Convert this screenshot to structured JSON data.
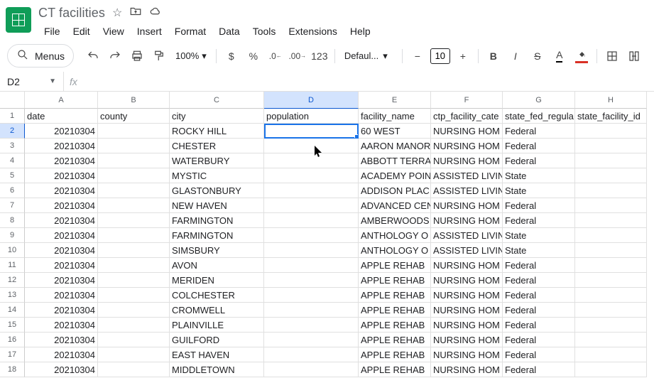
{
  "header": {
    "doc_title": "CT facilities",
    "star_icon": "star-icon",
    "move_icon": "move-icon",
    "cloud_icon": "cloud-icon"
  },
  "menus": [
    "File",
    "Edit",
    "View",
    "Insert",
    "Format",
    "Data",
    "Tools",
    "Extensions",
    "Help"
  ],
  "toolbar": {
    "search_label": "Menus",
    "zoom": "100%",
    "font": "Defaul...",
    "font_size": "10",
    "format_number": "123"
  },
  "name_box": {
    "ref": "D2",
    "fx": "fx"
  },
  "columns": [
    {
      "letter": "A",
      "cls": "w-a"
    },
    {
      "letter": "B",
      "cls": "w-b"
    },
    {
      "letter": "C",
      "cls": "w-c"
    },
    {
      "letter": "D",
      "cls": "w-d",
      "selected": true
    },
    {
      "letter": "E",
      "cls": "w-e"
    },
    {
      "letter": "F",
      "cls": "w-f"
    },
    {
      "letter": "G",
      "cls": "w-g"
    },
    {
      "letter": "H",
      "cls": "w-h"
    }
  ],
  "col_widths": [
    "w-a",
    "w-b",
    "w-c",
    "w-d",
    "w-e",
    "w-f",
    "w-g",
    "w-h"
  ],
  "active_cell": {
    "row": 2,
    "col": 3
  },
  "rows": [
    {
      "n": 1,
      "cells": [
        "date",
        "county",
        "city",
        "population",
        "facility_name",
        "ctp_facility_cate",
        "state_fed_regula",
        "state_facility_id"
      ],
      "num_cols": []
    },
    {
      "n": 2,
      "cells": [
        "20210304",
        "",
        "ROCKY HILL",
        "",
        "60 WEST",
        "NURSING HOM",
        "Federal",
        ""
      ],
      "num_cols": [
        0
      ],
      "selected": true
    },
    {
      "n": 3,
      "cells": [
        "20210304",
        "",
        "CHESTER",
        "",
        "AARON MANOR",
        "NURSING HOM",
        "Federal",
        ""
      ],
      "num_cols": [
        0
      ]
    },
    {
      "n": 4,
      "cells": [
        "20210304",
        "",
        "WATERBURY",
        "",
        "ABBOTT TERRA",
        "NURSING HOM",
        "Federal",
        ""
      ],
      "num_cols": [
        0
      ]
    },
    {
      "n": 5,
      "cells": [
        "20210304",
        "",
        "MYSTIC",
        "",
        "ACADEMY POIN",
        "ASSISTED LIVIN",
        "State",
        ""
      ],
      "num_cols": [
        0
      ]
    },
    {
      "n": 6,
      "cells": [
        "20210304",
        "",
        "GLASTONBURY",
        "",
        "ADDISON PLAC",
        "ASSISTED LIVIN",
        "State",
        ""
      ],
      "num_cols": [
        0
      ]
    },
    {
      "n": 7,
      "cells": [
        "20210304",
        "",
        "NEW HAVEN",
        "",
        "ADVANCED CEN",
        "NURSING HOM",
        "Federal",
        ""
      ],
      "num_cols": [
        0
      ]
    },
    {
      "n": 8,
      "cells": [
        "20210304",
        "",
        "FARMINGTON",
        "",
        "AMBERWOODS",
        "NURSING HOM",
        "Federal",
        ""
      ],
      "num_cols": [
        0
      ]
    },
    {
      "n": 9,
      "cells": [
        "20210304",
        "",
        "FARMINGTON",
        "",
        "ANTHOLOGY O",
        "ASSISTED LIVIN",
        "State",
        ""
      ],
      "num_cols": [
        0
      ]
    },
    {
      "n": 10,
      "cells": [
        "20210304",
        "",
        "SIMSBURY",
        "",
        "ANTHOLOGY O",
        "ASSISTED LIVIN",
        "State",
        ""
      ],
      "num_cols": [
        0
      ]
    },
    {
      "n": 11,
      "cells": [
        "20210304",
        "",
        "AVON",
        "",
        "APPLE REHAB",
        "NURSING HOM",
        "Federal",
        ""
      ],
      "num_cols": [
        0
      ]
    },
    {
      "n": 12,
      "cells": [
        "20210304",
        "",
        "MERIDEN",
        "",
        "APPLE REHAB",
        "NURSING HOM",
        "Federal",
        ""
      ],
      "num_cols": [
        0
      ]
    },
    {
      "n": 13,
      "cells": [
        "20210304",
        "",
        "COLCHESTER",
        "",
        "APPLE REHAB",
        "NURSING HOM",
        "Federal",
        ""
      ],
      "num_cols": [
        0
      ]
    },
    {
      "n": 14,
      "cells": [
        "20210304",
        "",
        "CROMWELL",
        "",
        "APPLE REHAB",
        "NURSING HOM",
        "Federal",
        ""
      ],
      "num_cols": [
        0
      ]
    },
    {
      "n": 15,
      "cells": [
        "20210304",
        "",
        "PLAINVILLE",
        "",
        "APPLE REHAB",
        "NURSING HOM",
        "Federal",
        ""
      ],
      "num_cols": [
        0
      ]
    },
    {
      "n": 16,
      "cells": [
        "20210304",
        "",
        "GUILFORD",
        "",
        "APPLE REHAB",
        "NURSING HOM",
        "Federal",
        ""
      ],
      "num_cols": [
        0
      ]
    },
    {
      "n": 17,
      "cells": [
        "20210304",
        "",
        "EAST HAVEN",
        "",
        "APPLE REHAB",
        "NURSING HOM",
        "Federal",
        ""
      ],
      "num_cols": [
        0
      ]
    },
    {
      "n": 18,
      "cells": [
        "20210304",
        "",
        "MIDDLETOWN",
        "",
        "APPLE REHAB",
        "NURSING HOM",
        "Federal",
        ""
      ],
      "num_cols": [
        0
      ]
    }
  ]
}
